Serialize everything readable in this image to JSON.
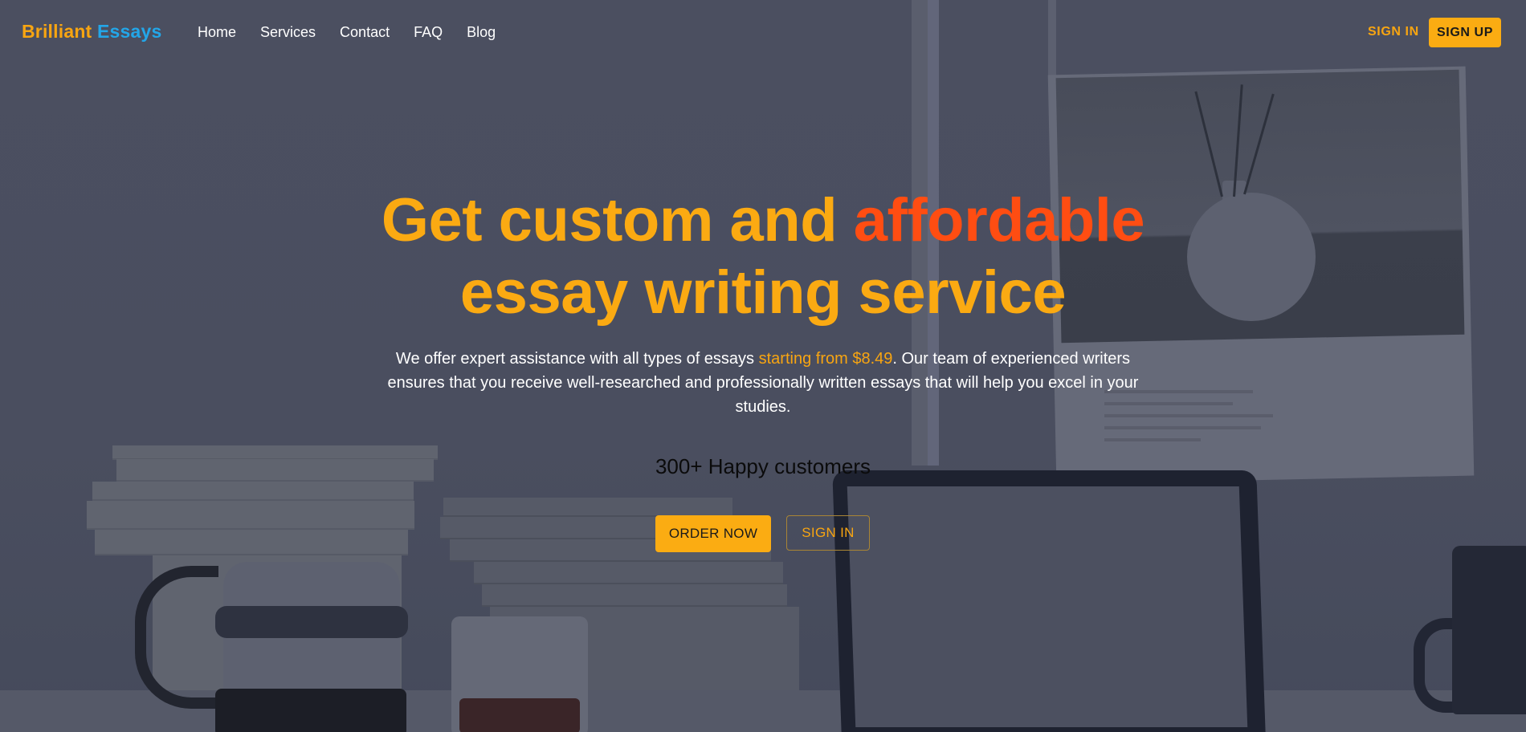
{
  "brand": {
    "name_part1": "Brilliant",
    "name_part2": "Essays",
    "color_part1": "#f8a511",
    "color_part2": "#23a6e8"
  },
  "nav": {
    "links": [
      {
        "label": "Home"
      },
      {
        "label": "Services"
      },
      {
        "label": "Contact"
      },
      {
        "label": "FAQ"
      },
      {
        "label": "Blog"
      }
    ],
    "sign_in_label": "SIGN IN",
    "sign_up_label": "SIGN UP"
  },
  "hero": {
    "headline_part1": "Get custom and ",
    "headline_highlight": "affordable",
    "headline_part2": "essay writing service",
    "subtext_before": "We offer expert assistance with all types of essays ",
    "subtext_price": "starting from $8.49",
    "subtext_after": ". Our team of experienced writers ensures that you receive well-researched and professionally written essays that will help you excel in your studies.",
    "customers": "300+ Happy customers",
    "order_button": "ORDER NOW",
    "signin_button": "SIGN IN"
  },
  "colors": {
    "accent": "#fbac12",
    "highlight": "#ff4d12",
    "overlay": "#4a4e5e"
  }
}
